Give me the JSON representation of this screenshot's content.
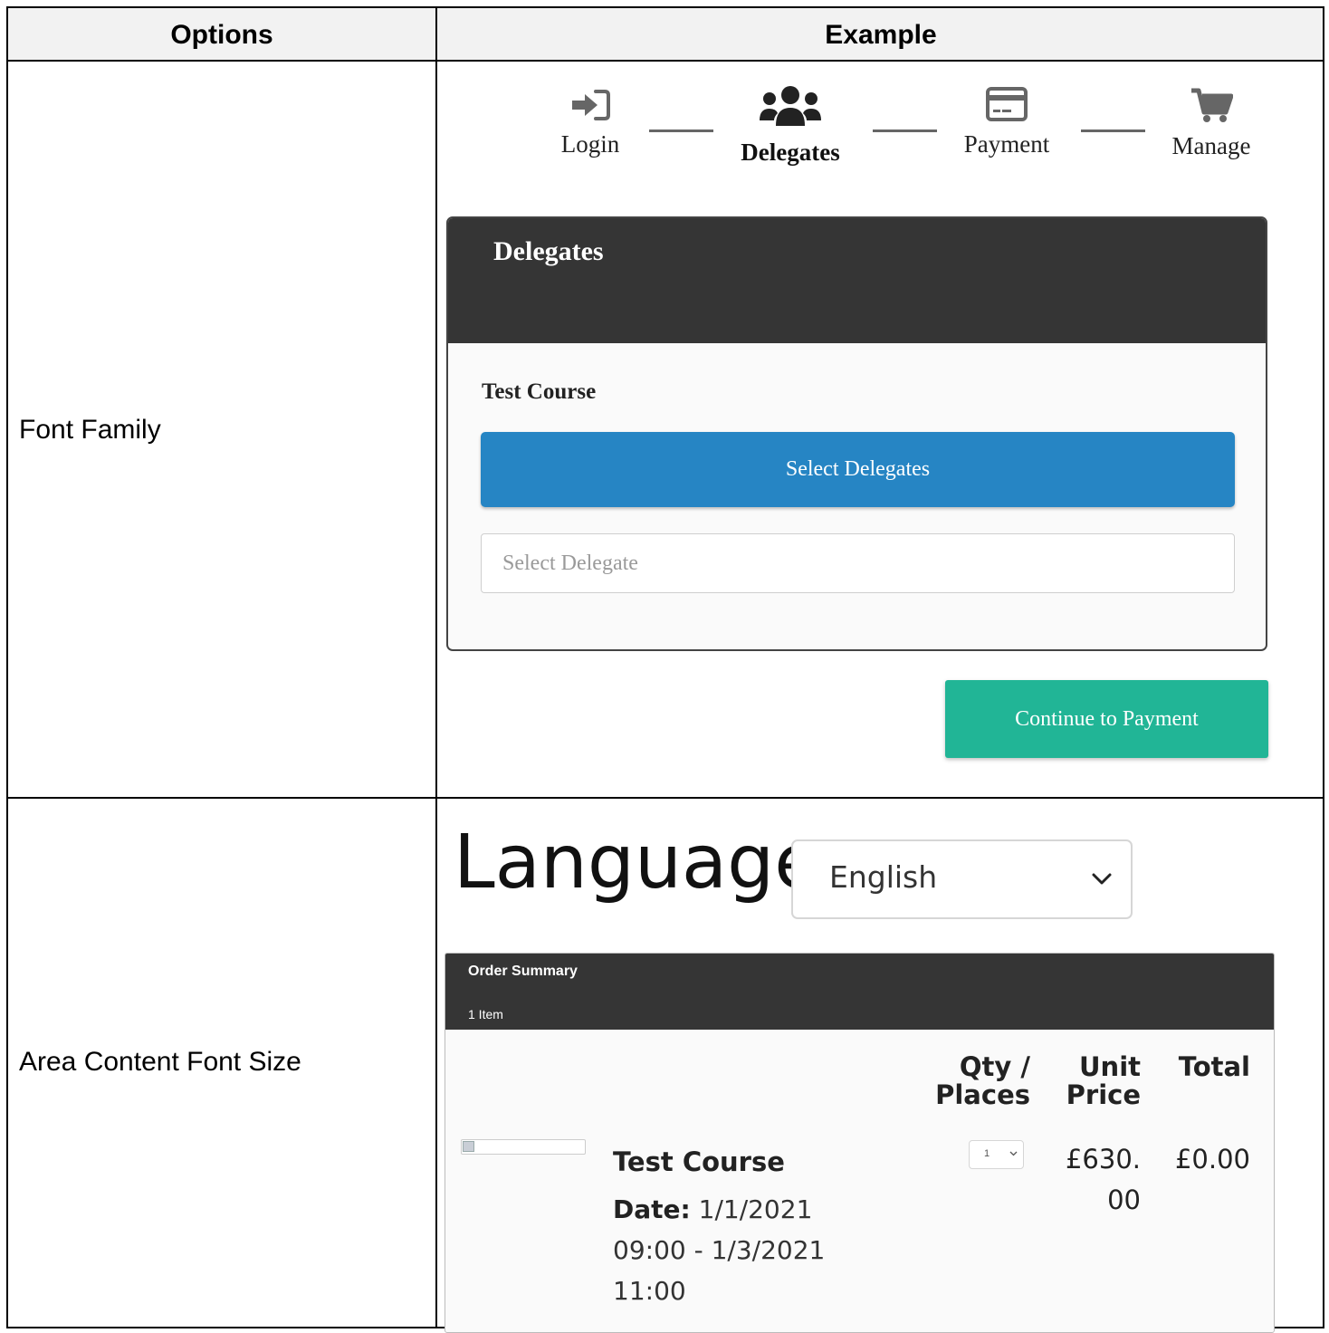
{
  "table": {
    "headers": {
      "options": "Options",
      "example": "Example"
    },
    "rows": [
      {
        "option": "Font Family"
      },
      {
        "option": "Area Content Font Size"
      }
    ]
  },
  "stepper": {
    "steps": [
      {
        "label": "Login",
        "icon": "sign-in-icon",
        "active": false
      },
      {
        "label": "Delegates",
        "icon": "users-icon",
        "active": true
      },
      {
        "label": "Payment",
        "icon": "credit-card-icon",
        "active": false
      },
      {
        "label": "Manage",
        "icon": "cart-icon",
        "active": false
      }
    ]
  },
  "delegates_card": {
    "title": "Delegates",
    "course": "Test Course",
    "select_button": "Select Delegates",
    "select_placeholder": "Select Delegate"
  },
  "continue_button": "Continue to Payment",
  "language": {
    "label": "Language",
    "selected": "English"
  },
  "order_summary": {
    "title": "Order Summary",
    "count": "1 Item",
    "columns": {
      "qty_1": "Qty /",
      "qty_2": "Places",
      "unit_1": "Unit",
      "unit_2": "Price",
      "total": "Total"
    },
    "item": {
      "name": "Test Course",
      "date_label": "Date:",
      "date_value": "1/1/2021 09:00 - 1/3/2021 11:00",
      "qty": "1",
      "unit_price_1": "£630.",
      "unit_price_2": "00",
      "total": "£0.00"
    }
  },
  "colors": {
    "header_dark": "#353535",
    "primary_blue": "#2685c4",
    "success_green": "#21b596",
    "table_header_bg": "#f2f2f2"
  }
}
